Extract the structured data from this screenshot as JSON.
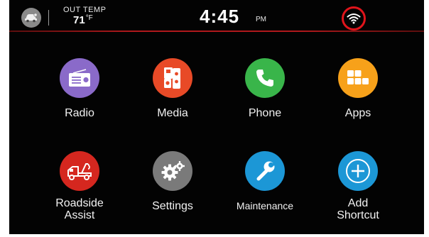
{
  "status": {
    "car_icon": "car-settings-icon",
    "temp_label": "OUT TEMP",
    "temp_value": "71",
    "temp_unit": "°F",
    "time": "4:45",
    "ampm": "PM",
    "wifi_icon": "wifi-icon"
  },
  "colors": {
    "radio": "#8a6ac9",
    "media": "#e84a27",
    "phone": "#39b54a",
    "apps": "#f7a11a",
    "roadside": "#d5271f",
    "settings": "#7a7a7a",
    "maintenance": "#1c97d6",
    "shortcut": "#1c97d6",
    "wifi_highlight": "#e0141b"
  },
  "apps": {
    "radio": {
      "label": "Radio",
      "icon": "radio-icon"
    },
    "media": {
      "label": "Media",
      "icon": "media-icon"
    },
    "phone": {
      "label": "Phone",
      "icon": "phone-icon"
    },
    "apps": {
      "label": "Apps",
      "icon": "apps-grid-icon"
    },
    "roadside": {
      "label1": "Roadside",
      "label2": "Assist",
      "icon": "tow-truck-icon"
    },
    "settings": {
      "label": "Settings",
      "icon": "gears-icon"
    },
    "maintenance": {
      "label": "Maintenance",
      "icon": "wrench-icon"
    },
    "shortcut": {
      "label1": "Add",
      "label2": "Shortcut",
      "icon": "plus-circle-icon"
    }
  }
}
